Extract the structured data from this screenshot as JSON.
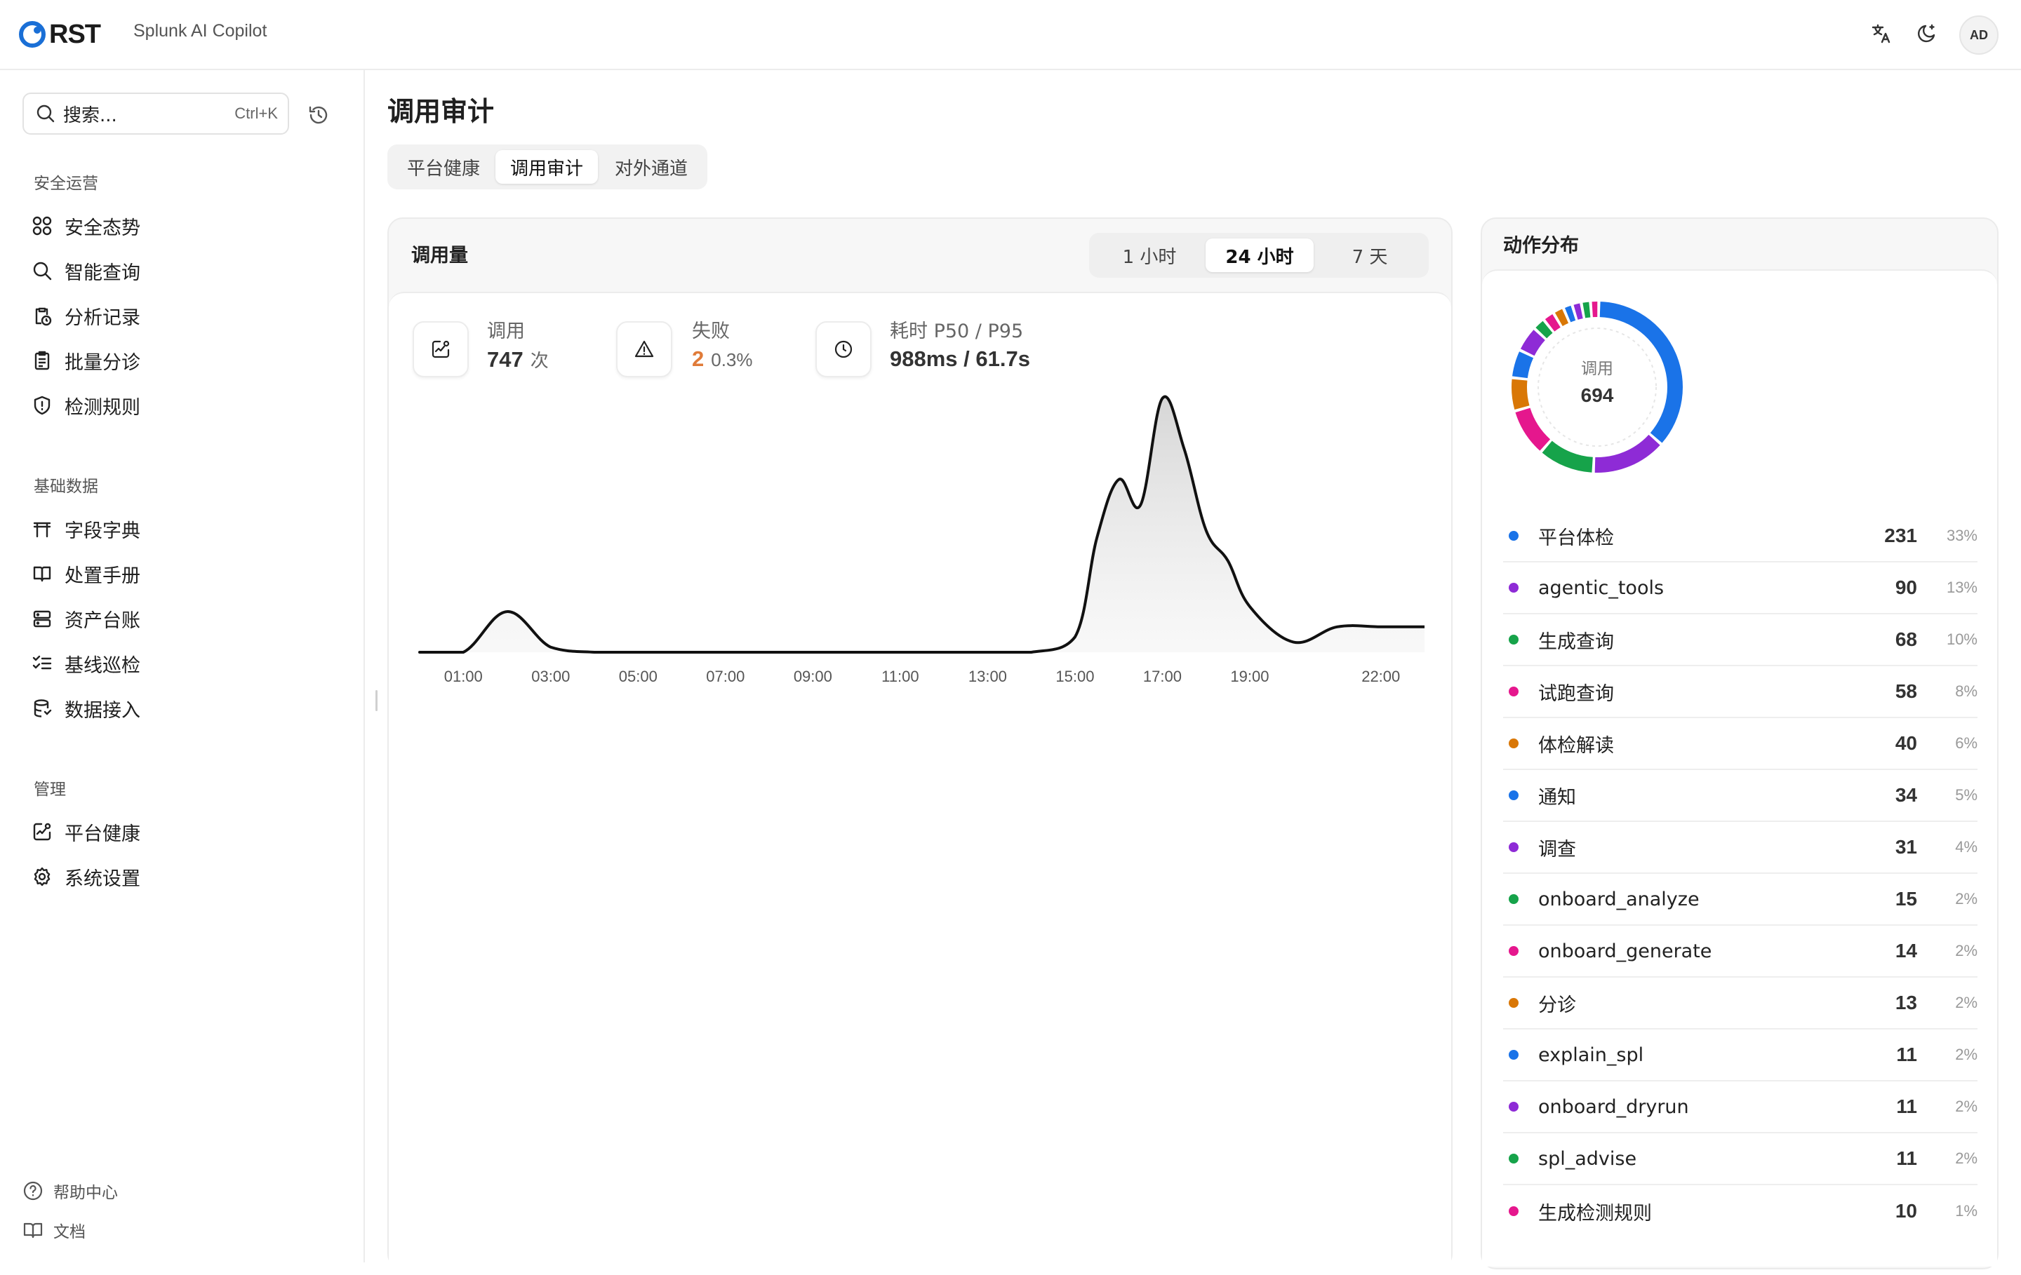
{
  "header": {
    "logo_text": "RST",
    "app_name": "Splunk AI Copilot",
    "avatar": "AD",
    "icons": [
      "translate-icon",
      "theme-moon-icon"
    ]
  },
  "sidebar": {
    "search_placeholder": "搜索...",
    "search_shortcut": "Ctrl+K",
    "sections": [
      {
        "title": "安全运营",
        "items": [
          {
            "label": "安全态势",
            "icon": "grid-icon"
          },
          {
            "label": "智能查询",
            "icon": "search-icon"
          },
          {
            "label": "分析记录",
            "icon": "clipboard-clock-icon"
          },
          {
            "label": "批量分诊",
            "icon": "clipboard-list-icon"
          },
          {
            "label": "检测规则",
            "icon": "shield-alert-icon"
          }
        ]
      },
      {
        "title": "基础数据",
        "items": [
          {
            "label": "字段字典",
            "icon": "table-icon"
          },
          {
            "label": "处置手册",
            "icon": "book-icon"
          },
          {
            "label": "资产台账",
            "icon": "server-icon"
          },
          {
            "label": "基线巡检",
            "icon": "list-checks-icon"
          },
          {
            "label": "数据接入",
            "icon": "database-icon"
          }
        ]
      },
      {
        "title": "管理",
        "items": [
          {
            "label": "平台健康",
            "icon": "activity-icon"
          },
          {
            "label": "系统设置",
            "icon": "gear-icon"
          }
        ]
      }
    ],
    "footer": [
      {
        "label": "帮助中心",
        "icon": "help-circle-icon"
      },
      {
        "label": "文档",
        "icon": "book-open-icon"
      }
    ]
  },
  "main": {
    "title": "调用审计",
    "tabs": [
      {
        "label": "平台健康",
        "active": false
      },
      {
        "label": "调用审计",
        "active": true
      },
      {
        "label": "对外通道",
        "active": false
      }
    ],
    "calls_card": {
      "title": "调用量",
      "ranges": [
        {
          "label": "1 小时",
          "active": false
        },
        {
          "label": "24 小时",
          "active": true
        },
        {
          "label": "7 天",
          "active": false
        }
      ],
      "stats": {
        "calls": {
          "label": "调用",
          "value": "747",
          "unit": "次"
        },
        "failures": {
          "label": "失败",
          "value": "2",
          "pct": "0.3%",
          "color": "#e07b39"
        },
        "latency": {
          "label": "耗时 P50 / P95",
          "value": "988ms / 61.7s"
        }
      }
    },
    "action_card": {
      "title": "动作分布",
      "donut_label": "调用",
      "donut_total": "694",
      "rows": [
        {
          "name": "平台体检",
          "count": "231",
          "pct": "33%",
          "color": "#1a73e8"
        },
        {
          "name": "agentic_tools",
          "count": "90",
          "pct": "13%",
          "color": "#8e2bd6"
        },
        {
          "name": "生成查询",
          "count": "68",
          "pct": "10%",
          "color": "#16a34a"
        },
        {
          "name": "试跑查询",
          "count": "58",
          "pct": "8%",
          "color": "#e5178d"
        },
        {
          "name": "体检解读",
          "count": "40",
          "pct": "6%",
          "color": "#d97706"
        },
        {
          "name": "通知",
          "count": "34",
          "pct": "5%",
          "color": "#1a73e8"
        },
        {
          "name": "调查",
          "count": "31",
          "pct": "4%",
          "color": "#8e2bd6"
        },
        {
          "name": "onboard_analyze",
          "count": "15",
          "pct": "2%",
          "color": "#16a34a"
        },
        {
          "name": "onboard_generate",
          "count": "14",
          "pct": "2%",
          "color": "#e5178d"
        },
        {
          "name": "分诊",
          "count": "13",
          "pct": "2%",
          "color": "#d97706"
        },
        {
          "name": "explain_spl",
          "count": "11",
          "pct": "2%",
          "color": "#1a73e8"
        },
        {
          "name": "onboard_dryrun",
          "count": "11",
          "pct": "2%",
          "color": "#8e2bd6"
        },
        {
          "name": "spl_advise",
          "count": "11",
          "pct": "2%",
          "color": "#16a34a"
        },
        {
          "name": "生成检测规则",
          "count": "10",
          "pct": "1%",
          "color": "#e5178d"
        }
      ]
    }
  },
  "chart_data": [
    {
      "type": "area",
      "x_ticks": [
        "01:00",
        "03:00",
        "05:00",
        "07:00",
        "09:00",
        "11:00",
        "13:00",
        "15:00",
        "17:00",
        "19:00",
        "22:00"
      ],
      "x_hours": [
        0,
        1,
        2,
        3,
        4,
        5,
        6,
        7,
        8,
        9,
        10,
        11,
        12,
        13,
        14,
        15,
        15.5,
        16,
        16.5,
        17,
        17.5,
        18,
        18.5,
        19,
        20,
        21,
        22,
        23
      ],
      "values": [
        0,
        0,
        16,
        2,
        0,
        0,
        0,
        0,
        0,
        0,
        0,
        0,
        0,
        0,
        0,
        6,
        45,
        68,
        58,
        100,
        80,
        48,
        36,
        18,
        4,
        10,
        10,
        10
      ],
      "grid": false,
      "color": "#111111"
    },
    {
      "type": "pie",
      "categories": [
        "平台体检",
        "agentic_tools",
        "生成查询",
        "试跑查询",
        "体检解读",
        "通知",
        "调查",
        "onboard_analyze",
        "onboard_generate",
        "分诊",
        "explain_spl",
        "onboard_dryrun",
        "spl_advise",
        "生成检测规则"
      ],
      "values": [
        231,
        90,
        68,
        58,
        40,
        34,
        31,
        15,
        14,
        13,
        11,
        11,
        11,
        10
      ],
      "total": 694
    }
  ]
}
